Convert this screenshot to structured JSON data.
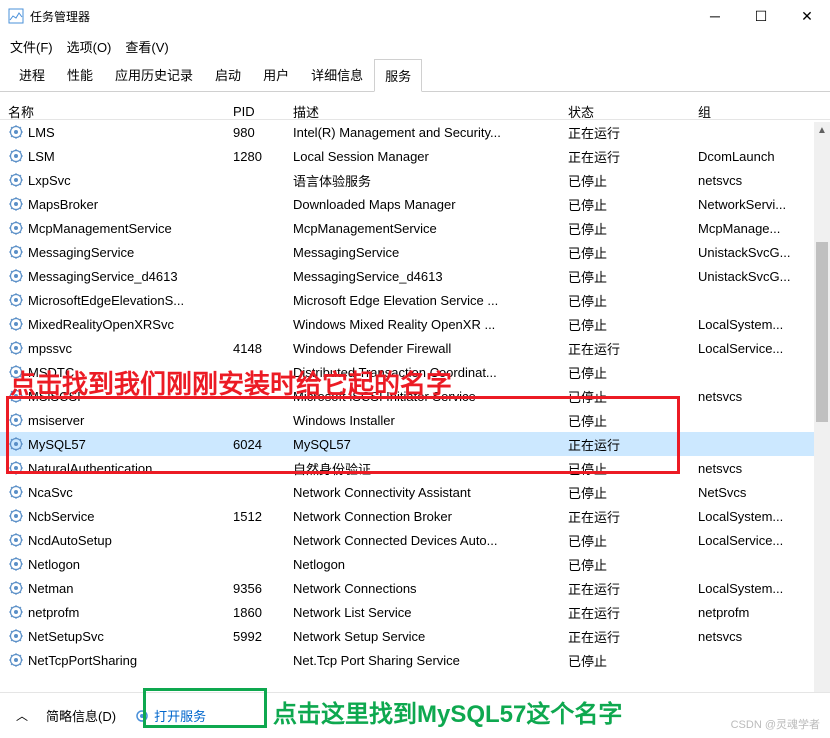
{
  "window": {
    "title": "任务管理器"
  },
  "menus": {
    "file": "文件(F)",
    "options": "选项(O)",
    "view": "查看(V)"
  },
  "tabs": {
    "processes": "进程",
    "performance": "性能",
    "appHistory": "应用历史记录",
    "startup": "启动",
    "users": "用户",
    "details": "详细信息",
    "services": "服务"
  },
  "columns": {
    "name": "名称",
    "pid": "PID",
    "desc": "描述",
    "state": "状态",
    "group": "组"
  },
  "rows": [
    {
      "name": "LMS",
      "pid": "980",
      "desc": "Intel(R) Management and Security...",
      "state": "正在运行",
      "group": ""
    },
    {
      "name": "LSM",
      "pid": "1280",
      "desc": "Local Session Manager",
      "state": "正在运行",
      "group": "DcomLaunch"
    },
    {
      "name": "LxpSvc",
      "pid": "",
      "desc": "语言体验服务",
      "state": "已停止",
      "group": "netsvcs"
    },
    {
      "name": "MapsBroker",
      "pid": "",
      "desc": "Downloaded Maps Manager",
      "state": "已停止",
      "group": "NetworkServi..."
    },
    {
      "name": "McpManagementService",
      "pid": "",
      "desc": "McpManagementService",
      "state": "已停止",
      "group": "McpManage..."
    },
    {
      "name": "MessagingService",
      "pid": "",
      "desc": "MessagingService",
      "state": "已停止",
      "group": "UnistackSvcG..."
    },
    {
      "name": "MessagingService_d4613",
      "pid": "",
      "desc": "MessagingService_d4613",
      "state": "已停止",
      "group": "UnistackSvcG..."
    },
    {
      "name": "MicrosoftEdgeElevationS...",
      "pid": "",
      "desc": "Microsoft Edge Elevation Service ...",
      "state": "已停止",
      "group": ""
    },
    {
      "name": "MixedRealityOpenXRSvc",
      "pid": "",
      "desc": "Windows Mixed Reality OpenXR ...",
      "state": "已停止",
      "group": "LocalSystem..."
    },
    {
      "name": "mpssvc",
      "pid": "4148",
      "desc": "Windows Defender Firewall",
      "state": "正在运行",
      "group": "LocalService..."
    },
    {
      "name": "MSDTC",
      "pid": "",
      "desc": "Distributed Transaction Coordinat...",
      "state": "已停止",
      "group": ""
    },
    {
      "name": "MSiSCSI",
      "pid": "",
      "desc": "Microsoft iSCSI Initiator Service",
      "state": "已停止",
      "group": "netsvcs"
    },
    {
      "name": "msiserver",
      "pid": "",
      "desc": "Windows Installer",
      "state": "已停止",
      "group": ""
    },
    {
      "name": "MySQL57",
      "pid": "6024",
      "desc": "MySQL57",
      "state": "正在运行",
      "group": "",
      "selected": true
    },
    {
      "name": "NaturalAuthentication",
      "pid": "",
      "desc": "自然身份验证",
      "state": "已停止",
      "group": "netsvcs"
    },
    {
      "name": "NcaSvc",
      "pid": "",
      "desc": "Network Connectivity Assistant",
      "state": "已停止",
      "group": "NetSvcs"
    },
    {
      "name": "NcbService",
      "pid": "1512",
      "desc": "Network Connection Broker",
      "state": "正在运行",
      "group": "LocalSystem..."
    },
    {
      "name": "NcdAutoSetup",
      "pid": "",
      "desc": "Network Connected Devices Auto...",
      "state": "已停止",
      "group": "LocalService..."
    },
    {
      "name": "Netlogon",
      "pid": "",
      "desc": "Netlogon",
      "state": "已停止",
      "group": ""
    },
    {
      "name": "Netman",
      "pid": "9356",
      "desc": "Network Connections",
      "state": "正在运行",
      "group": "LocalSystem..."
    },
    {
      "name": "netprofm",
      "pid": "1860",
      "desc": "Network List Service",
      "state": "正在运行",
      "group": "netprofm"
    },
    {
      "name": "NetSetupSvc",
      "pid": "5992",
      "desc": "Network Setup Service",
      "state": "正在运行",
      "group": "netsvcs"
    },
    {
      "name": "NetTcpPortSharing",
      "pid": "",
      "desc": "Net.Tcp Port Sharing Service",
      "state": "已停止",
      "group": ""
    }
  ],
  "footer": {
    "fewer": "简略信息(D)",
    "openServices": "打开服务"
  },
  "annotations": {
    "redText": "点击找到我们刚刚安装时给它起的名字",
    "greenText": "点击这里找到MySQL57这个名字"
  },
  "watermark": "CSDN @灵魂学者"
}
